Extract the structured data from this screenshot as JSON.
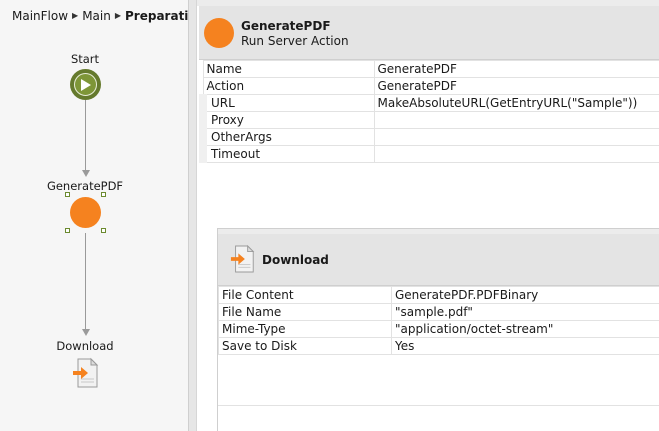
{
  "breadcrumb": {
    "items": [
      "MainFlow",
      "Main"
    ],
    "current": "Preparation"
  },
  "flow": {
    "start_label": "Start",
    "action_label": "GeneratePDF",
    "download_label": "Download"
  },
  "action_panel": {
    "title": "GeneratePDF",
    "subtitle": "Run Server Action",
    "properties": [
      {
        "key": "Name",
        "value": "GeneratePDF"
      },
      {
        "key": "Action",
        "value": "GeneratePDF"
      },
      {
        "key": "URL",
        "value": "MakeAbsoluteURL(GetEntryURL(\"Sample\"))"
      },
      {
        "key": "Proxy",
        "value": ""
      },
      {
        "key": "OtherArgs",
        "value": ""
      },
      {
        "key": "Timeout",
        "value": ""
      }
    ]
  },
  "download_panel": {
    "title": "Download",
    "properties": [
      {
        "key": "File Content",
        "value": "GeneratePDF.PDFBinary"
      },
      {
        "key": "File Name",
        "value": "\"sample.pdf\""
      },
      {
        "key": "Mime-Type",
        "value": "\"application/octet-stream\""
      },
      {
        "key": "Save to Disk",
        "value": "Yes"
      }
    ]
  },
  "colors": {
    "start_node": "#7e9637",
    "action_node": "#f5821f",
    "header_bg": "#e4e4e4"
  },
  "icons": {
    "start": "play-icon",
    "action": "server-action-icon",
    "download": "download-icon"
  }
}
